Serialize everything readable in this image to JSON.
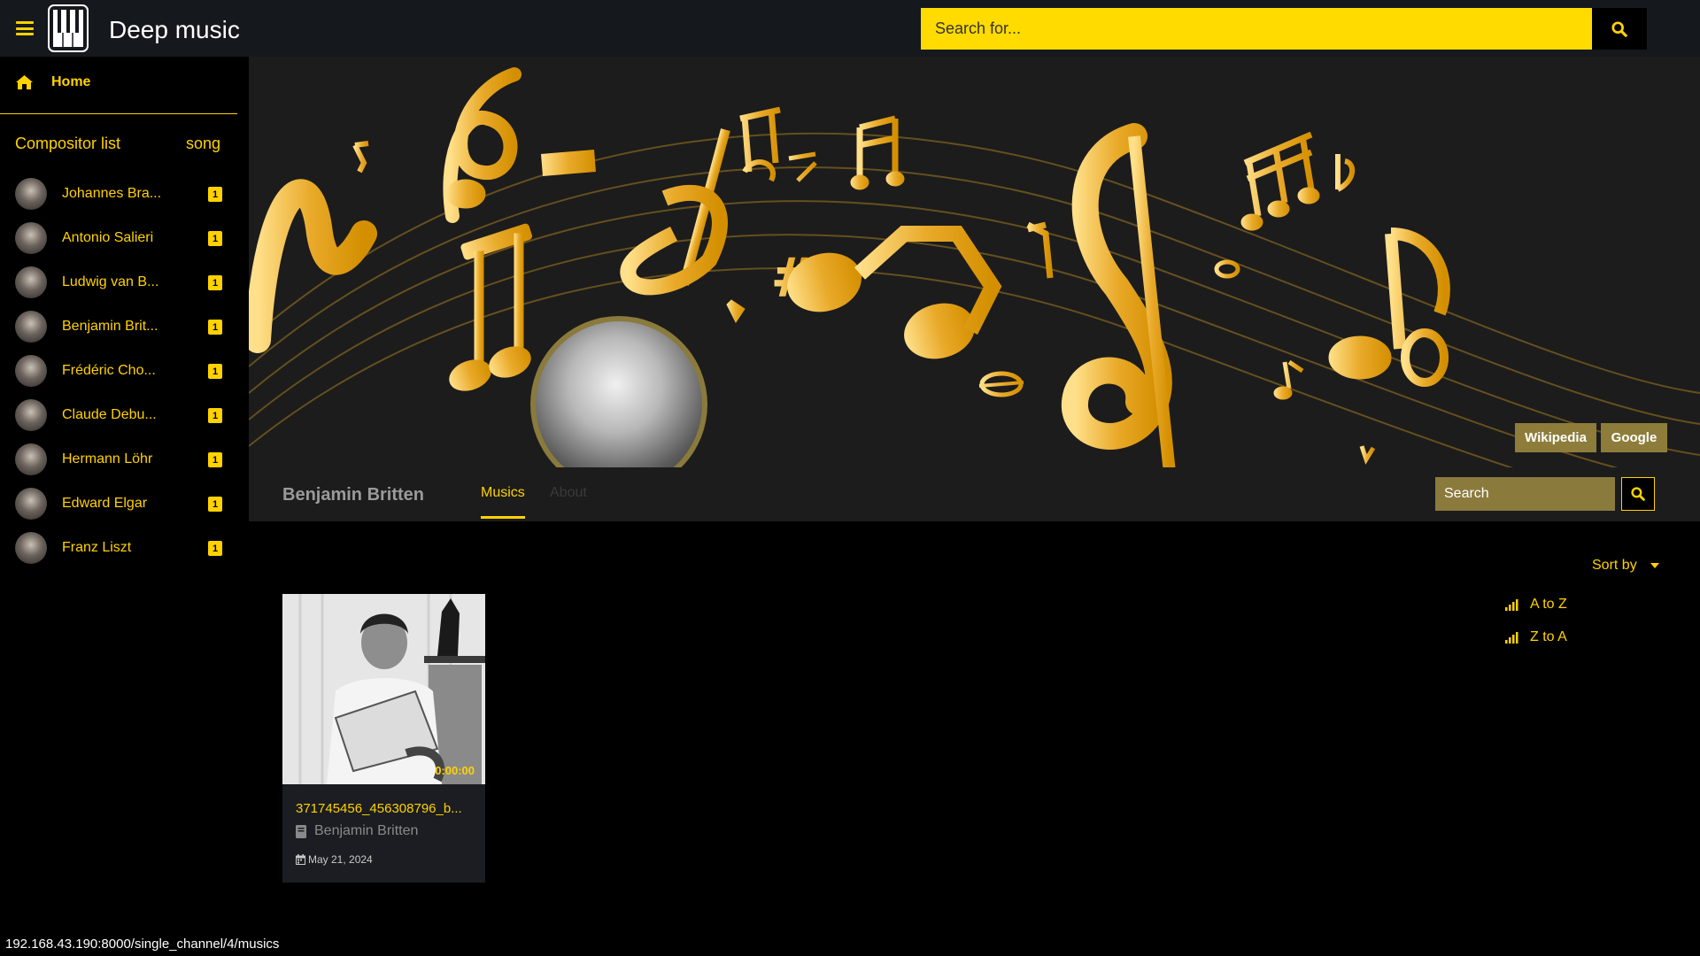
{
  "header": {
    "brand": "Deep music",
    "search_placeholder": "Search for..."
  },
  "sidebar": {
    "home_label": "Home",
    "list_title": "Compositor list",
    "list_count_label": "song",
    "composers": [
      {
        "name": "Johannes Bra...",
        "count": "1"
      },
      {
        "name": "Antonio Salieri",
        "count": "1"
      },
      {
        "name": "Ludwig van B...",
        "count": "1"
      },
      {
        "name": "Benjamin Brit...",
        "count": "1"
      },
      {
        "name": "Frédéric Cho...",
        "count": "1"
      },
      {
        "name": "Claude Debu...",
        "count": "1"
      },
      {
        "name": "Hermann Löhr",
        "count": "1"
      },
      {
        "name": "Edward Elgar",
        "count": "1"
      },
      {
        "name": "Franz Liszt",
        "count": "1"
      }
    ]
  },
  "banner": {
    "wikipedia_label": "Wikipedia",
    "google_label": "Google"
  },
  "channel": {
    "name": "Benjamin Britten",
    "tabs": [
      {
        "label": "Musics",
        "active": true
      },
      {
        "label": "About",
        "active": false
      }
    ],
    "search_placeholder": "Search"
  },
  "sort": {
    "label": "Sort by",
    "options": [
      "A to Z",
      "Z to A"
    ]
  },
  "music_card": {
    "duration": "0:00:00",
    "title": "371745456_456308796_b...",
    "author": "Benjamin Britten",
    "date": "May 21, 2024"
  },
  "status_url": "192.168.43.190:8000/single_channel/4/musics",
  "colors": {
    "accent": "#ffd200",
    "topbar_bg": "#15181d",
    "panel_bg": "#1c1c1c",
    "gold_dark": "#8a7a3c"
  }
}
